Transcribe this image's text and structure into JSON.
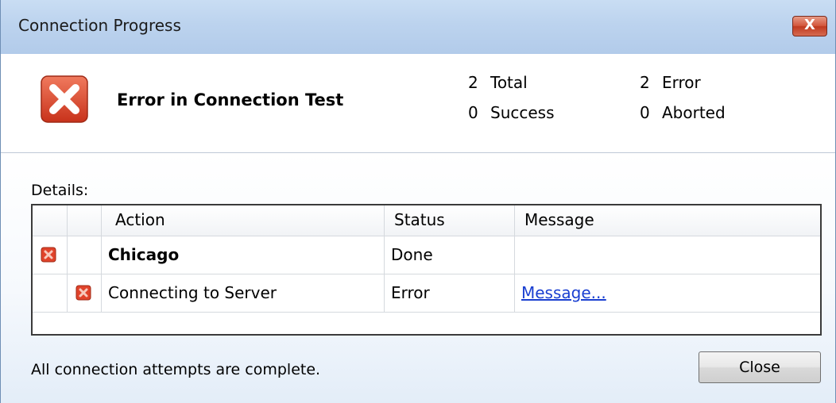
{
  "window": {
    "title": "Connection Progress",
    "close_glyph": "X"
  },
  "header": {
    "icon": "error-icon",
    "title": "Error in Connection Test",
    "stats": {
      "total": {
        "count": "2",
        "label": "Total"
      },
      "success": {
        "count": "0",
        "label": "Success"
      },
      "error": {
        "count": "2",
        "label": "Error"
      },
      "aborted": {
        "count": "0",
        "label": "Aborted"
      }
    }
  },
  "details": {
    "label": "Details:",
    "columns": [
      "",
      "",
      "Action",
      "Status",
      "Message"
    ],
    "rows": [
      {
        "icon": "error-icon",
        "action": "Chicago",
        "status": "Done",
        "message": ""
      },
      {
        "icon": "error-icon",
        "action": "Connecting to Server",
        "status": "Error",
        "message": "Message..."
      }
    ]
  },
  "footer": {
    "status_text": "All connection attempts are complete.",
    "close_label": "Close"
  },
  "colors": {
    "error_red": "#e0432b",
    "link_blue": "#1a3fd1",
    "title_bar": "#bcd3ee"
  }
}
